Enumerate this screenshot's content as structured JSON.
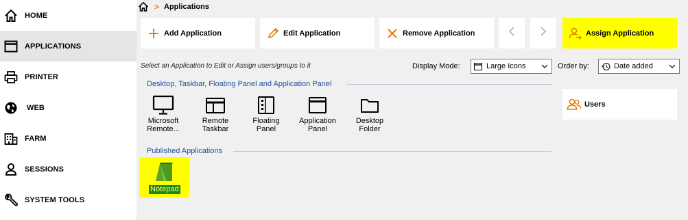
{
  "sidebar": {
    "items": [
      {
        "label": "HOME",
        "icon": "home-icon"
      },
      {
        "label": "APPLICATIONS",
        "icon": "window-icon",
        "active": true
      },
      {
        "label": "PRINTER",
        "icon": "printer-icon"
      },
      {
        "label": "WEB",
        "icon": "globe-icon"
      },
      {
        "label": "FARM",
        "icon": "building-icon"
      },
      {
        "label": "SESSIONS",
        "icon": "user-icon"
      },
      {
        "label": "SYSTEM TOOLS",
        "icon": "wrench-icon"
      }
    ]
  },
  "breadcrumb": {
    "current": "Applications",
    "separator": ">"
  },
  "toolbar": {
    "add_label": "Add Application",
    "edit_label": "Edit Application",
    "remove_label": "Remove Application",
    "assign_label": "Assign Application"
  },
  "hint": "Select an Application to Edit or Assign users/groups to it",
  "display_mode": {
    "label": "Display Mode:",
    "value": "Large Icons"
  },
  "order_by": {
    "label": "Order by:",
    "value": "Date added"
  },
  "groups": {
    "desktop_title": "Desktop, Taskbar, Floating Panel and Application Panel",
    "published_title": "Published Applications"
  },
  "apps": [
    {
      "line1": "Microsoft",
      "line2": "Remote...",
      "icon": "monitor-icon"
    },
    {
      "line1": "Remote",
      "line2": "Taskbar",
      "icon": "taskbar-icon"
    },
    {
      "line1": "Floating",
      "line2": "Panel",
      "icon": "floating-panel-icon"
    },
    {
      "line1": "Application",
      "line2": "Panel",
      "icon": "application-panel-icon"
    },
    {
      "line1": "Desktop",
      "line2": "Folder",
      "icon": "folder-icon"
    }
  ],
  "published": [
    {
      "label": "Notepad",
      "icon": "notepad-icon"
    }
  ],
  "users_panel": {
    "label": "Users"
  },
  "colors": {
    "accent": "#e67e00",
    "highlight": "#ffff00",
    "group_title": "#1f4e9c",
    "notepad_label_bg": "#1a8a1a"
  }
}
